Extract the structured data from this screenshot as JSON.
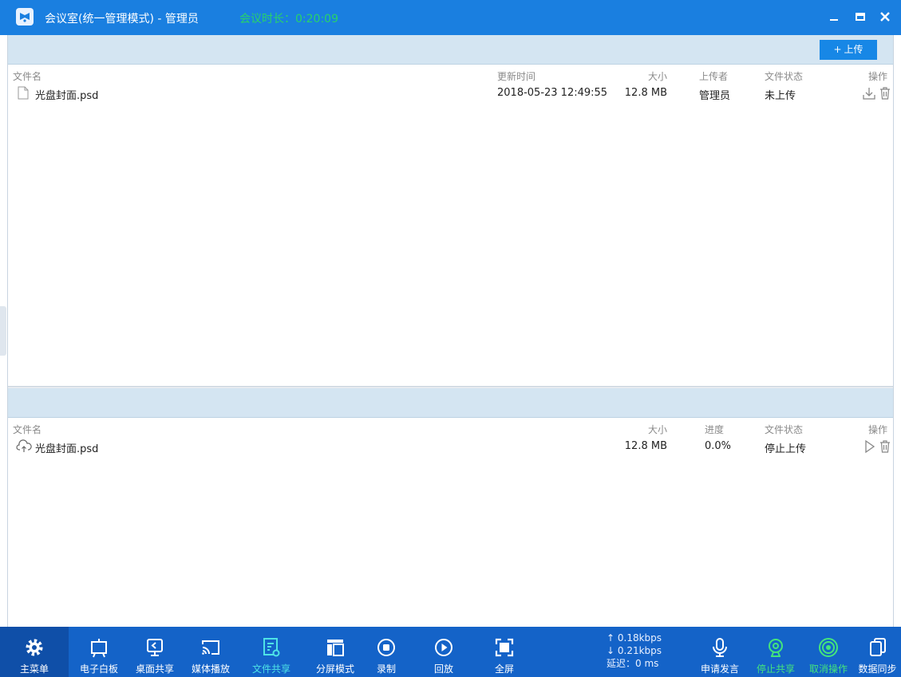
{
  "window": {
    "title": "会议室(统一管理模式) - 管理员",
    "duration_label": "会议时长：",
    "duration_value": "0:20:09"
  },
  "upload_panel": {
    "upload_button": "上传",
    "columns": {
      "name": "文件名",
      "updated": "更新时间",
      "size": "大小",
      "uploader": "上传者",
      "status": "文件状态",
      "action": "操作"
    },
    "rows": [
      {
        "name": "光盘封面.psd",
        "updated": "2018-05-23 12:49:55",
        "size": "12.8 MB",
        "uploader": "管理员",
        "status": "未上传"
      }
    ]
  },
  "transfer_panel": {
    "columns": {
      "name": "文件名",
      "size": "大小",
      "progress": "进度",
      "status": "文件状态",
      "action": "操作"
    },
    "rows": [
      {
        "name": "光盘封面.psd",
        "size": "12.8 MB",
        "progress": "0.0%",
        "status": "停止上传"
      }
    ]
  },
  "toolbar": {
    "main_menu": "主菜单",
    "whiteboard": "电子白板",
    "desktop_share": "桌面共享",
    "media_play": "媒体播放",
    "file_share": "文件共享",
    "split_mode": "分屏模式",
    "record": "录制",
    "playback": "回放",
    "fullscreen": "全屏",
    "net_up": "↑ 0.18kbps",
    "net_down": "↓ 0.21kbps",
    "latency": "延迟：0 ms",
    "request_speak": "申请发言",
    "stop_share": "停止共享",
    "cancel_op": "取消操作",
    "data_sync": "数据同步"
  },
  "colors": {
    "title_bar": "#1a7fe0",
    "toolbar": "#1463c8",
    "active_tool": "#4ee3e6",
    "green_tool": "#44e47c",
    "duration": "#28d26a"
  }
}
